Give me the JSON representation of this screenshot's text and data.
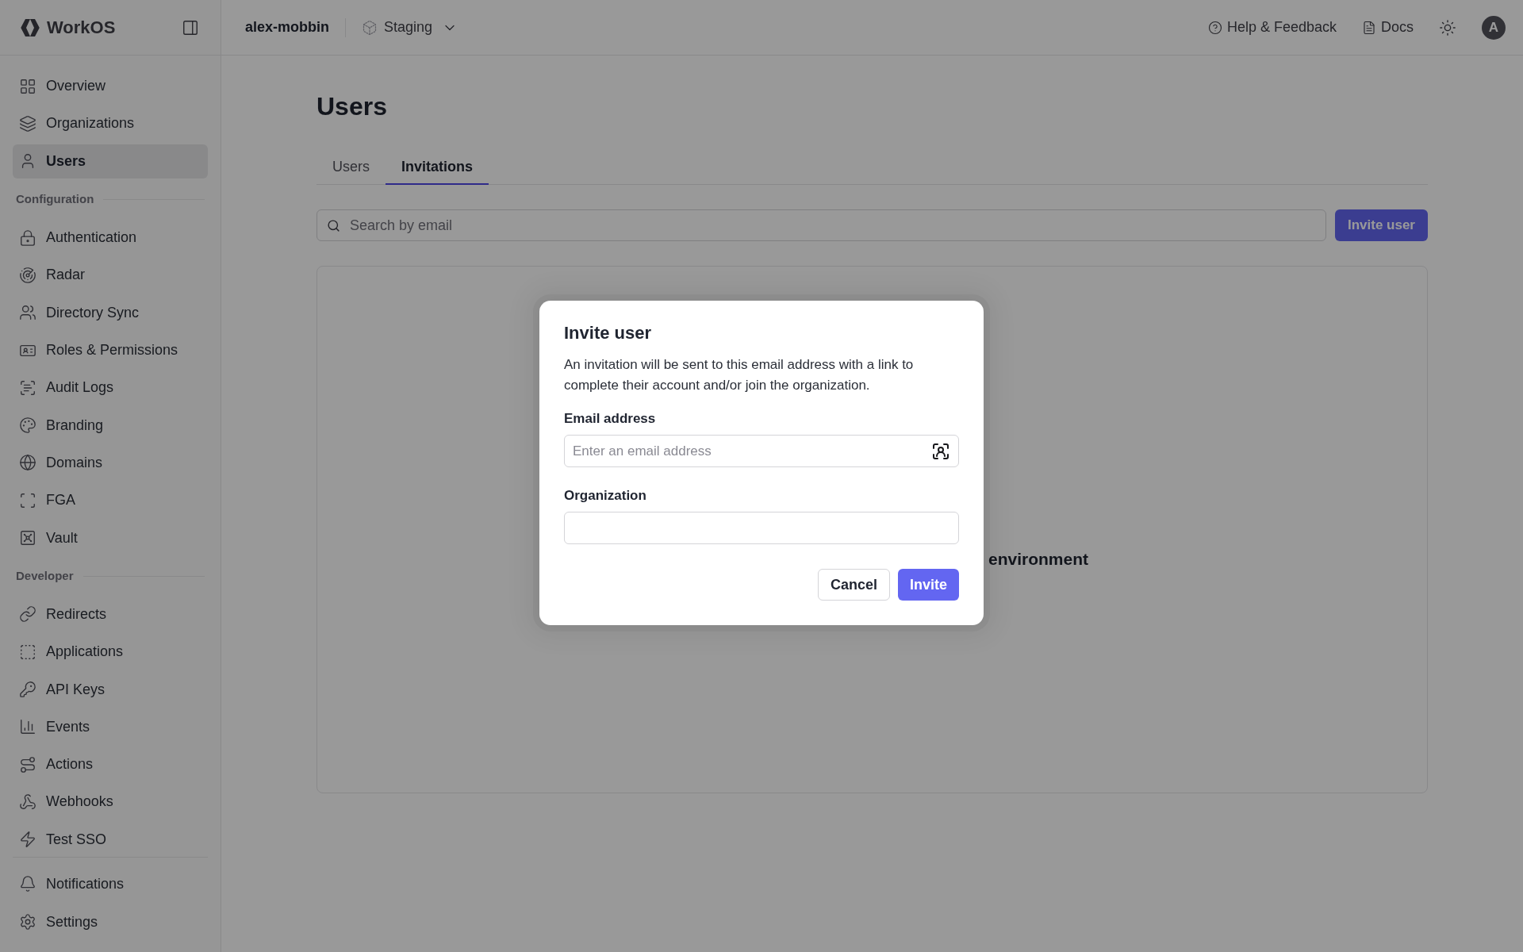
{
  "brand": {
    "name": "WorkOS"
  },
  "header": {
    "workspace": "alex-mobbin",
    "environment": "Staging",
    "links": [
      {
        "label": "Help & Feedback"
      },
      {
        "label": "Docs"
      }
    ],
    "avatar": "A"
  },
  "sidebar": {
    "sections": [
      {
        "items": [
          {
            "label": "Overview",
            "selected": false
          },
          {
            "label": "Organizations",
            "selected": false
          },
          {
            "label": "Users",
            "selected": true
          }
        ]
      },
      {
        "title": "Configuration",
        "items": [
          {
            "label": "Authentication",
            "selected": false
          },
          {
            "label": "Radar",
            "selected": false
          },
          {
            "label": "Directory Sync",
            "selected": false
          },
          {
            "label": "Roles & Permissions",
            "selected": false
          },
          {
            "label": "Audit Logs",
            "selected": false
          },
          {
            "label": "Branding",
            "selected": false
          },
          {
            "label": "Domains",
            "selected": false
          },
          {
            "label": "FGA",
            "selected": false
          },
          {
            "label": "Vault",
            "selected": false
          }
        ]
      },
      {
        "title": "Developer",
        "items": [
          {
            "label": "Redirects",
            "selected": false
          },
          {
            "label": "Applications",
            "selected": false
          },
          {
            "label": "API Keys",
            "selected": false
          },
          {
            "label": "Events",
            "selected": false
          },
          {
            "label": "Actions",
            "selected": false
          },
          {
            "label": "Webhooks",
            "selected": false
          },
          {
            "label": "Test SSO",
            "selected": false
          }
        ]
      }
    ],
    "footer_items": [
      {
        "label": "Notifications",
        "selected": false
      },
      {
        "label": "Settings",
        "selected": false
      }
    ]
  },
  "page": {
    "title": "Users",
    "tabs": [
      {
        "label": "Users",
        "selected": false
      },
      {
        "label": "Invitations",
        "selected": true
      }
    ],
    "search": {
      "placeholder": "Search by email"
    },
    "invite_button": "Invite user",
    "empty_state": {
      "text": "environment"
    }
  },
  "dialog": {
    "title": "Invite user",
    "description": "An invitation will be sent to this email address with a link to complete their account and/or join the organization.",
    "fields": [
      {
        "label": "Email address",
        "placeholder": "Enter an email address",
        "kind": "email"
      },
      {
        "label": "Organization",
        "kind": "text"
      }
    ],
    "buttons": [
      {
        "label": "Cancel",
        "kind": "secondary"
      },
      {
        "label": "Invite",
        "kind": "primary"
      }
    ]
  }
}
